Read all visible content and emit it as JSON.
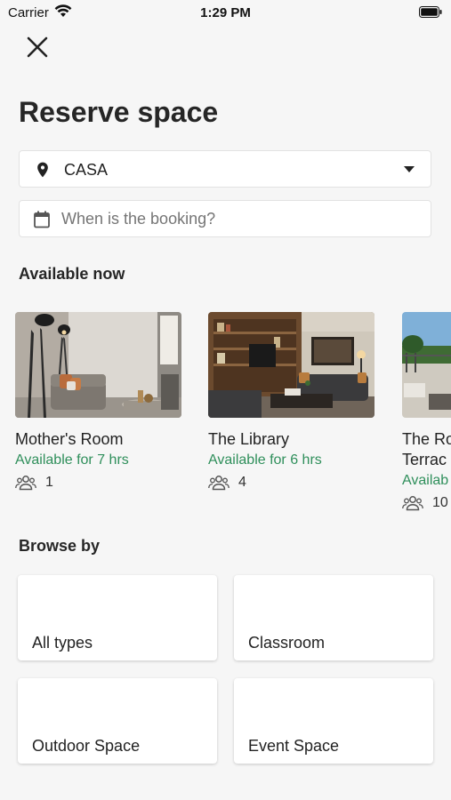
{
  "status_bar": {
    "carrier": "Carrier",
    "time": "1:29 PM"
  },
  "header": {
    "title": "Reserve space"
  },
  "location_select": {
    "value": "CASA"
  },
  "date_input": {
    "placeholder": "When is the booking?"
  },
  "available_now": {
    "heading": "Available now",
    "spaces": [
      {
        "name": "Mother's Room",
        "availability": "Available for 7 hrs",
        "capacity": "1"
      },
      {
        "name": "The Library",
        "availability": "Available for 6 hrs",
        "capacity": "4"
      },
      {
        "name": "The Ro\nTerrac",
        "availability": "Availab",
        "capacity": "10"
      }
    ]
  },
  "browse_by": {
    "heading": "Browse by",
    "types": [
      "All types",
      "Classroom",
      "Outdoor Space",
      "Event Space"
    ]
  },
  "colors": {
    "accent_green": "#2f8f5b",
    "background": "#f6f6f6"
  },
  "icons": [
    "wifi-icon",
    "battery-icon",
    "close-icon",
    "location-pin-icon",
    "chevron-down-icon",
    "calendar-icon",
    "people-icon"
  ]
}
